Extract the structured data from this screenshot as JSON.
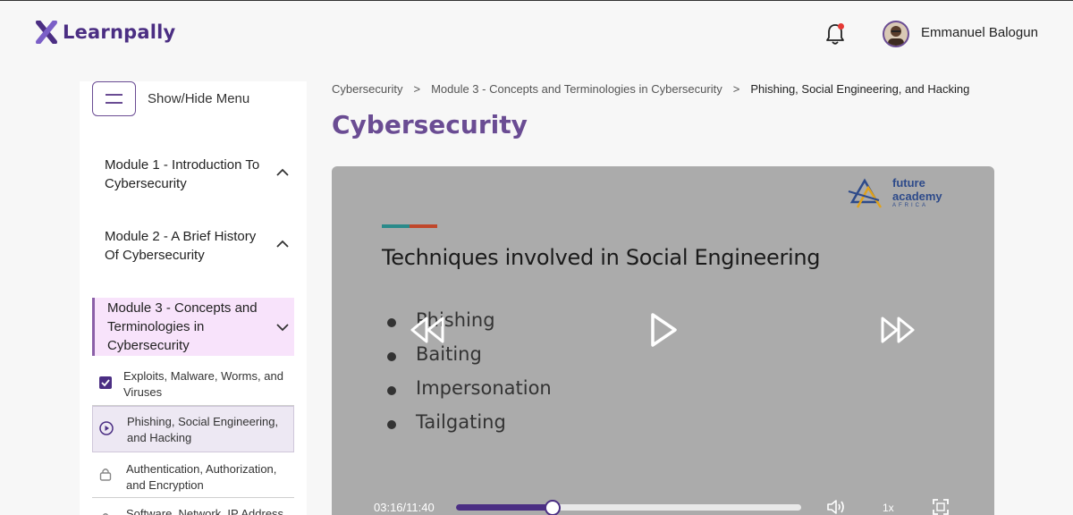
{
  "app": {
    "logo_text": "Learnpally",
    "user_name": "Emmanuel Balogun"
  },
  "sidebar": {
    "toggle_label": "Show/Hide Menu",
    "modules": [
      {
        "label": "Module 1 - Introduction To Cybersecurity",
        "state": "collapsed"
      },
      {
        "label": "Module 2 - A Brief History Of Cybersecurity",
        "state": "collapsed"
      },
      {
        "label": "Module 3 - Concepts and Terminologies in Cybersecurity",
        "state": "expanded",
        "active": true
      }
    ],
    "lessons": [
      {
        "label": "Exploits, Malware, Worms, and Viruses",
        "status": "completed",
        "icon": "checkbox-checked-icon"
      },
      {
        "label": "Phishing, Social Engineering, and Hacking",
        "status": "current",
        "icon": "play-circle-icon"
      },
      {
        "label": "Authentication, Authorization, and Encryption",
        "status": "locked",
        "icon": "lock-icon"
      },
      {
        "label": "Software, Network, IP Address",
        "status": "locked",
        "icon": "lock-icon"
      }
    ]
  },
  "breadcrumb": {
    "items": [
      "Cybersecurity",
      "Module 3 - Concepts and Terminologies in Cybersecurity",
      "Phishing, Social Engineering, and Hacking"
    ],
    "separator": ">"
  },
  "page": {
    "title": "Cybersecurity"
  },
  "video": {
    "brand_line1": "future",
    "brand_line2": "academy",
    "brand_sub": "AFRICA",
    "slide_title": "Techniques involved in Social Engineering",
    "bullets": [
      "Phishing",
      "Baiting",
      "Impersonation",
      "Tailgating"
    ],
    "time_display": "03:16/11:40",
    "progress_fraction": 0.28,
    "speed_label": "1x"
  },
  "colors": {
    "brand_purple": "#4b2e83",
    "title_purple": "#6a4c93",
    "active_module_bg": "#f8e3fb",
    "video_bg": "#ababab",
    "notification_dot": "#e53935"
  }
}
